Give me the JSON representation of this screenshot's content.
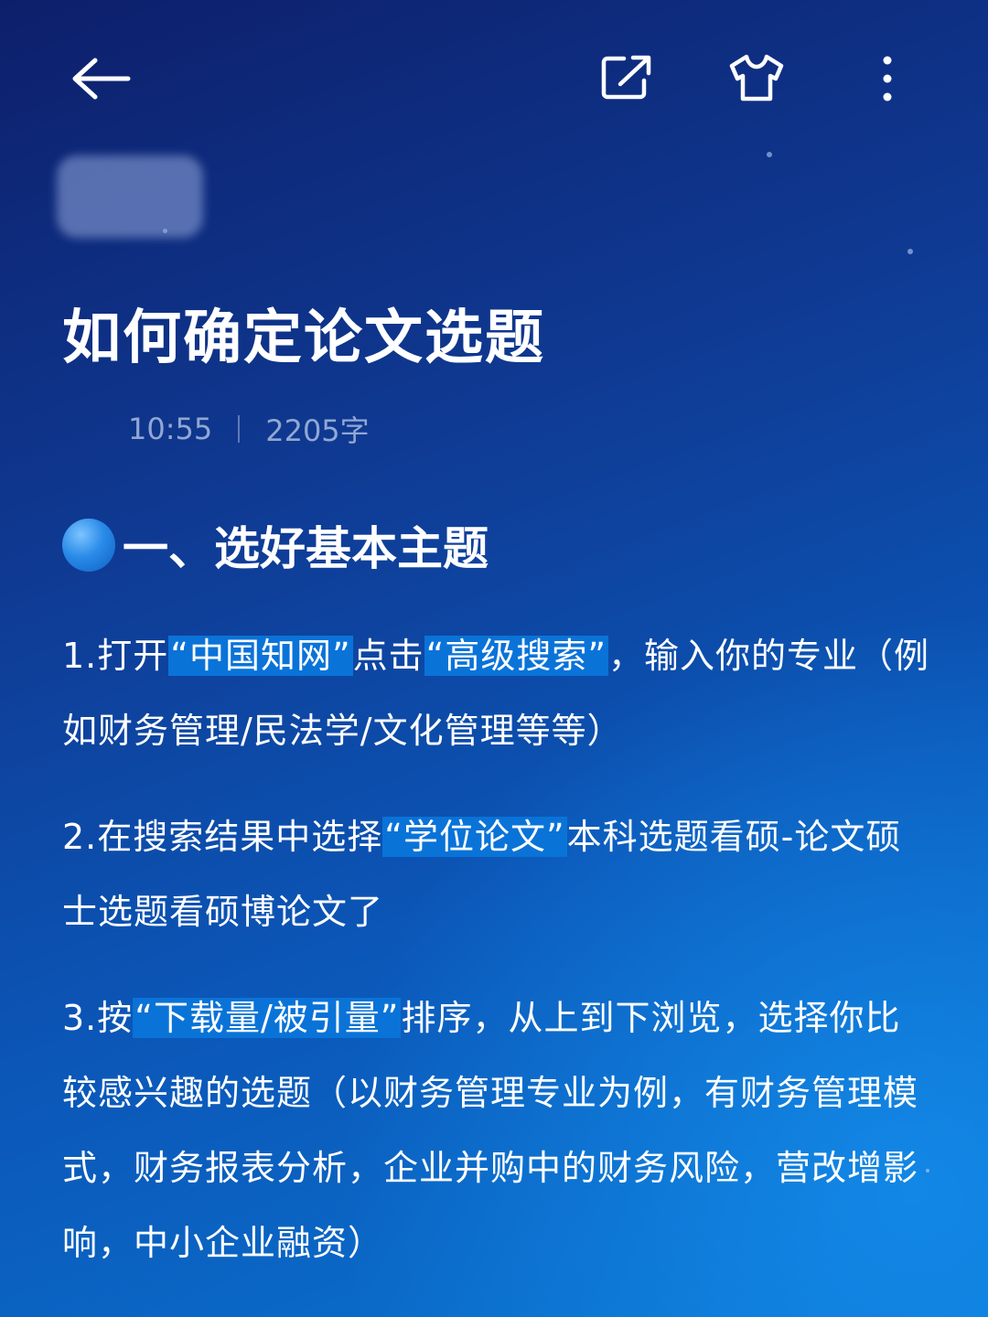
{
  "nav": {
    "back_icon": "arrow-left-icon",
    "share_icon": "share-external-icon",
    "theme_icon": "tshirt-icon",
    "more_icon": "more-vertical-icon"
  },
  "article": {
    "title": "如何确定论文选题",
    "meta_time": "10:55",
    "meta_words": "2205字",
    "section_heading": "一、选好基本主题",
    "p1": {
      "part1": "1.打开",
      "hl1": "“中国知网”",
      "part2": "点击",
      "hl2": "“高级搜索”",
      "part3": "，输入你的专业（例如财务管理/民法学/文化管理等等）"
    },
    "p2": {
      "part1": "2.在搜索结果中选择",
      "hl1": "“学位论文”",
      "part2": "本科选题看硕-论文硕士选题看硕博论文了"
    },
    "p3": {
      "part1": "3.按",
      "hl1": "“下载量/被引量”",
      "part2": "排序，从上到下浏览，选择你比较感兴趣的选题（以财务管理专业为例，有财务管理模式，财务报表分析，企业并购中的财务风险，营改增影响，中小企业融资）"
    }
  },
  "colors": {
    "highlight": "#0a73d8",
    "bg_dark": "#0d1f6b",
    "bg_light": "#0a74d0"
  }
}
